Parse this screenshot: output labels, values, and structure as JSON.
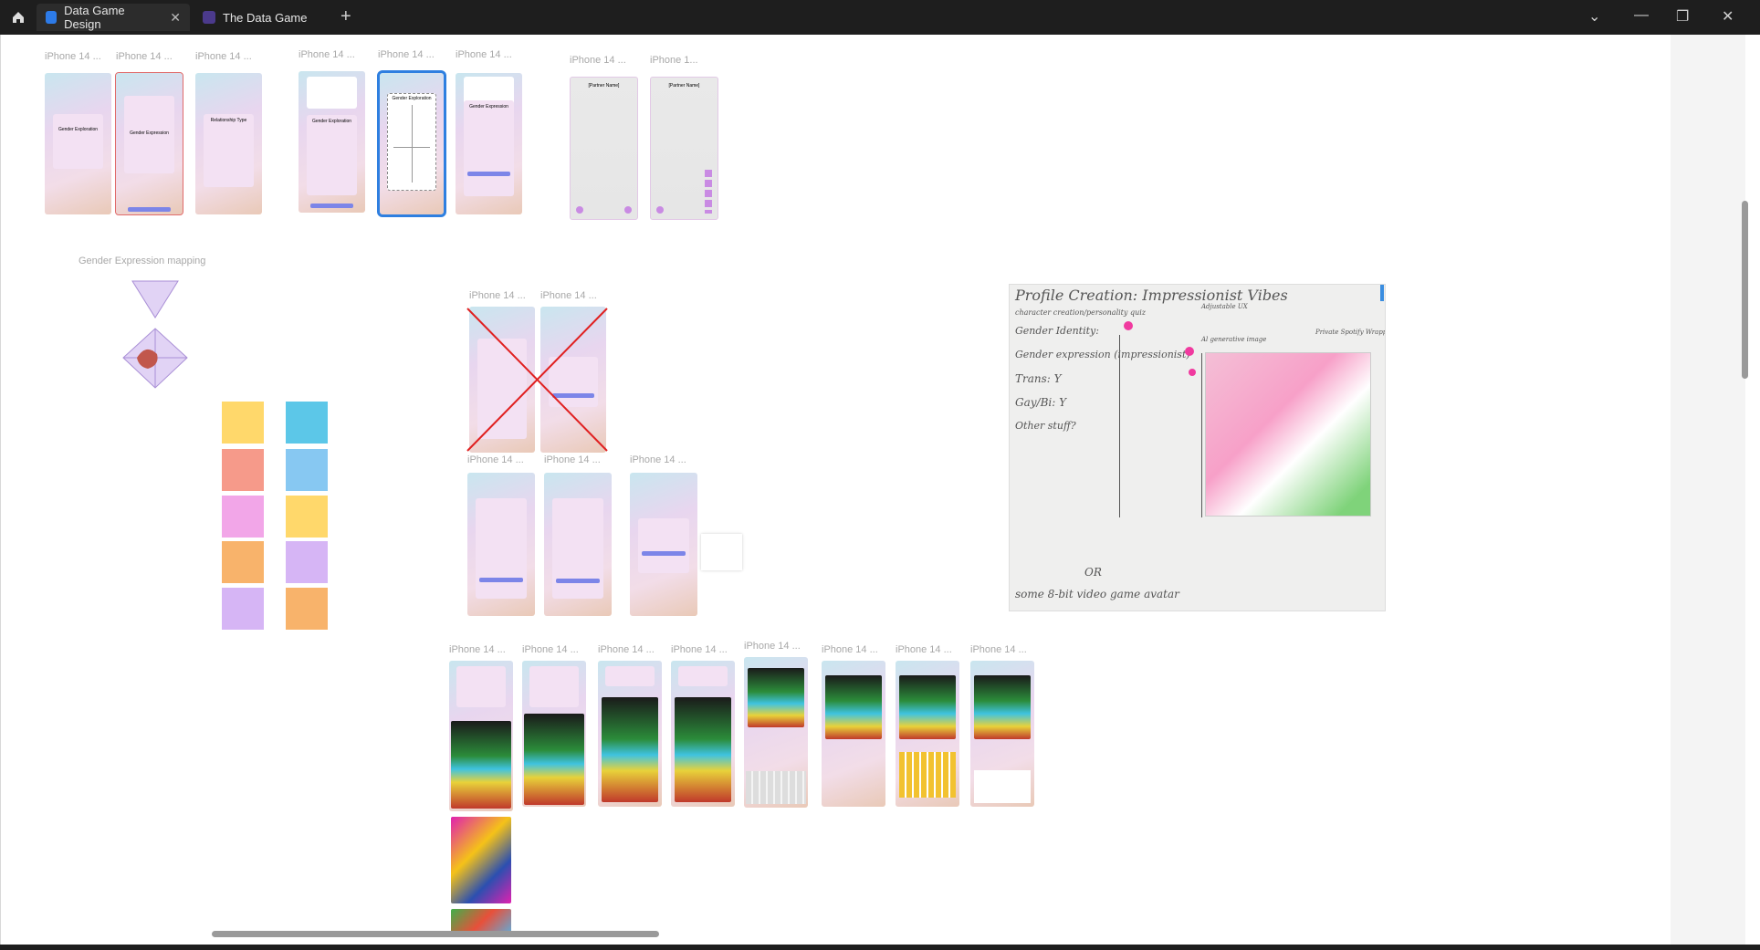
{
  "tabs": [
    {
      "label": "Data Game Design",
      "active": true
    },
    {
      "label": "The Data Game",
      "active": false
    }
  ],
  "frame_label": "iPhone 14 ...",
  "frame_label_alt": "iPhone 1...",
  "section_gender_mapping": "Gender Expression mapping",
  "screens": {
    "gender_exploration": "Gender Exploration",
    "gender_expression": "Gender Expression",
    "relationship_type": "Relationship Type",
    "partner_name": "[Partner Name]"
  },
  "colors": {
    "titlebar": "#1e1e1e",
    "button": "#7c85e8",
    "card": "#f3e1f3",
    "cross": "#e02020",
    "selection": "#e06a6a"
  },
  "handwriting": {
    "title": "Profile Creation: Impressionist Vibes",
    "subtitle": "character creation/personality quiz",
    "line1": "Gender Identity: ",
    "line2": "Gender expression (impressionist)",
    "line3": "Trans: Y",
    "line4": "Gay/Bi: Y",
    "line5": "Other stuff?",
    "or": "OR",
    "bottom": "some 8-bit video game avatar",
    "right1": "Private Spotify Wrapped Vibes",
    "right2": "Adjustable UX",
    "right3": "Al generative image"
  }
}
